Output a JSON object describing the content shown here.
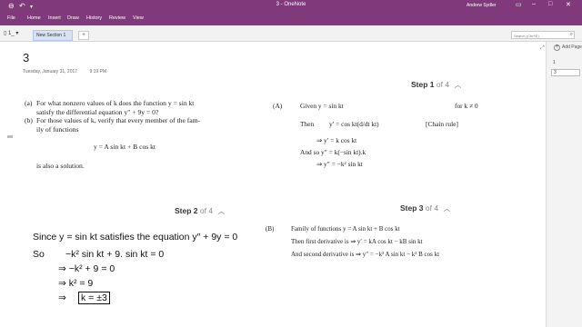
{
  "titlebar": {
    "title": "3 - OneNote",
    "user": "Andrew Sydler",
    "back_icon": "back-arrow",
    "undo_icon": "undo-arrow"
  },
  "ribbon": {
    "tabs": [
      "File",
      "Home",
      "Insert",
      "Draw",
      "History",
      "Review",
      "View"
    ]
  },
  "sectionbar": {
    "notebook": "1_",
    "section_tab": "New Section 1",
    "add_tab": "+",
    "search_placeholder": "Search (Ctrl+E)"
  },
  "right_pane": {
    "add_page": "Add Page",
    "pages": [
      "1",
      "3"
    ]
  },
  "page": {
    "title": "3",
    "date": "Tuesday, January 31, 2017",
    "time": "9:19 PM"
  },
  "problem": {
    "a_label": "(a)",
    "a_line1": "For what nonzero values of k does the function y = sin kt",
    "a_line2": "satisfy the differential equation y″ + 9y = 0?",
    "b_label": "(b)",
    "b_line1": "For those values of k, verify that every member of the fam-",
    "b_line2": "ily of functions",
    "b_eq": "y = A sin kt + B cos kt",
    "b_tail": "is also a solution."
  },
  "step1": {
    "label": "Step 1",
    "of": "of 4",
    "l1a": "(A)",
    "l1b": "Given  y = sin kt",
    "l1c": "for k ≠ 0",
    "l2a": "Then",
    "l2b": "y′ = cos kt(d/dt kt)",
    "l2c": "[Chain rule]",
    "l3": "⇒ y′ = k cos kt",
    "l4": "And so  y″ = k(−sin kt).k",
    "l5": "⇒ y″ = −k² sin kt"
  },
  "step2": {
    "label": "Step 2",
    "of": "of 4",
    "l1": "Since y = sin kt satisfies the equation  y″ + 9y = 0",
    "l2a": "So",
    "l2b": "−k² sin kt + 9. sin kt = 0",
    "l3": "⇒ −k² + 9 = 0",
    "l4": "⇒ k² = 9",
    "l5a": "⇒",
    "l5b": "k = ±3"
  },
  "step3": {
    "label": "Step 3",
    "of": "of 4",
    "l1a": "(B)",
    "l1b": "Family of functions  y = A sin kt + B cos kt",
    "l2": "Then first derivative is ⇒ y′ = kA cos kt − kB sin kt",
    "l3": "And second derivative is ⇒ y″ = −k² A sin kt − k² B cos kt"
  }
}
